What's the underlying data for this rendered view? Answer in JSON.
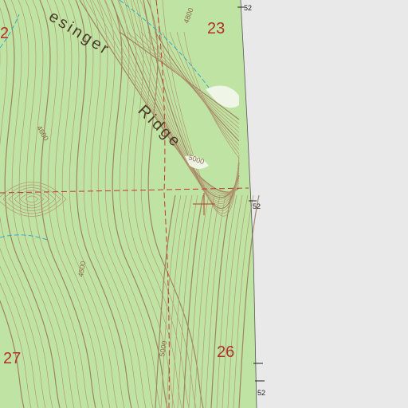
{
  "map": {
    "colors": {
      "land": "#bfe3a2",
      "outside": "#e9e9e9",
      "contour": "#b08c6c",
      "index_contour": "#9a7456",
      "section_line": "#c0392b",
      "stream": "#2aa6c8",
      "clearing": "#f4f7ef"
    },
    "feature_name": {
      "part1": "esinger",
      "part2": "Ridge"
    },
    "sections": [
      "2",
      "23",
      "27",
      "26"
    ],
    "elevation_labels": [
      "4800",
      "4600",
      "5000",
      "4500",
      "5000"
    ],
    "grid_ticks": [
      "52",
      "52",
      "52"
    ],
    "marker_icon": "crosshair-icon"
  }
}
